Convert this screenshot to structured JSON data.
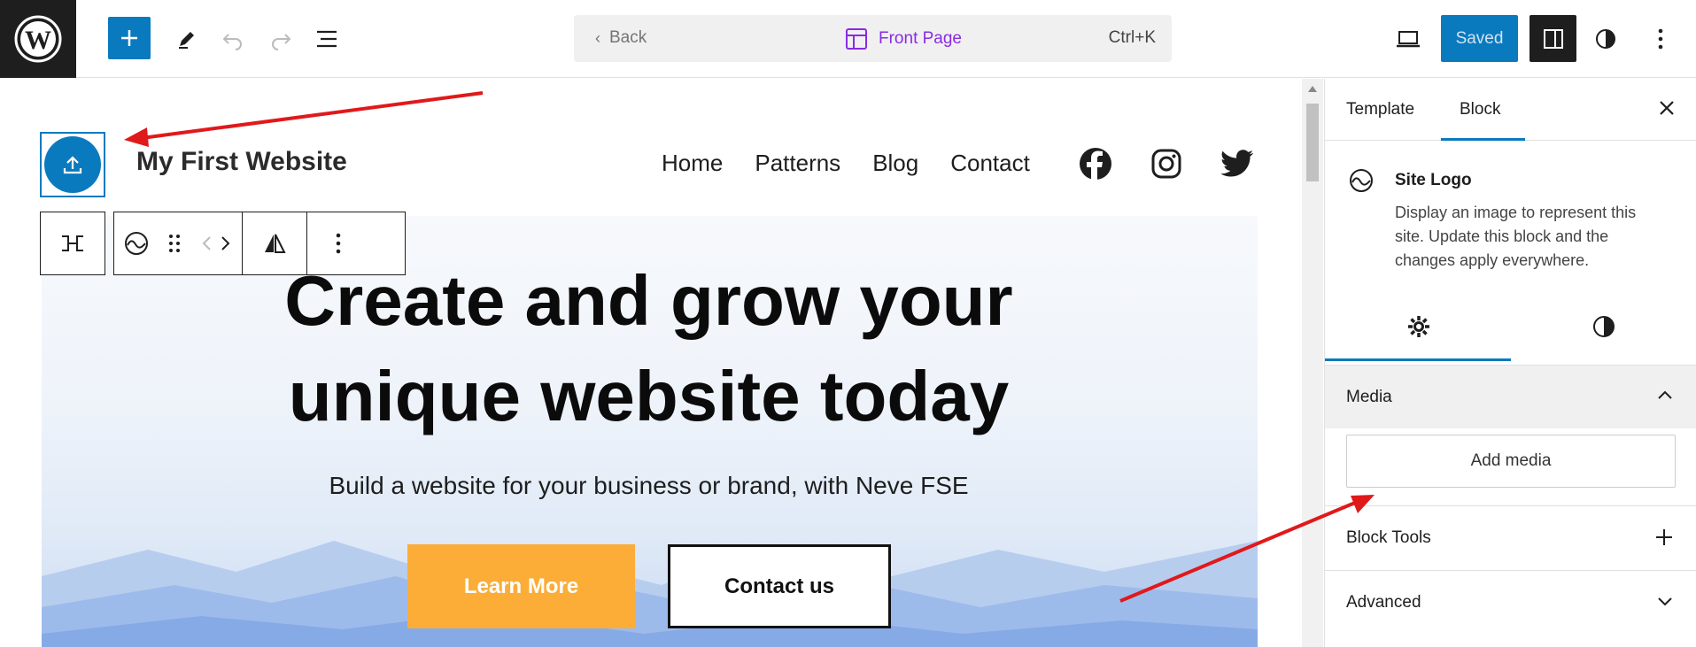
{
  "topbar": {
    "back_label": "Back",
    "page_label": "Front Page",
    "shortcut": "Ctrl+K",
    "saved_label": "Saved"
  },
  "site": {
    "title": "My First Website",
    "nav": [
      "Home",
      "Patterns",
      "Blog",
      "Contact"
    ]
  },
  "hero": {
    "title_line1": "Create and grow your",
    "title_line2": "unique website today",
    "subtitle": "Build a website for your business or brand, with Neve FSE",
    "learn_label": "Learn More",
    "contact_label": "Contact us"
  },
  "sidebar": {
    "tabs": [
      "Template",
      "Block"
    ],
    "active_tab": "Block",
    "block_title": "Site Logo",
    "block_desc": "Display an image to represent this site. Update this block and the changes apply everywhere.",
    "panels": {
      "media": "Media",
      "add_media": "Add media",
      "block_tools": "Block Tools",
      "advanced": "Advanced"
    }
  },
  "colors": {
    "accent": "#0a7abf",
    "purple": "#8a2be2",
    "learn_button": "#fbad38",
    "annotation_arrow": "#e0191b"
  }
}
